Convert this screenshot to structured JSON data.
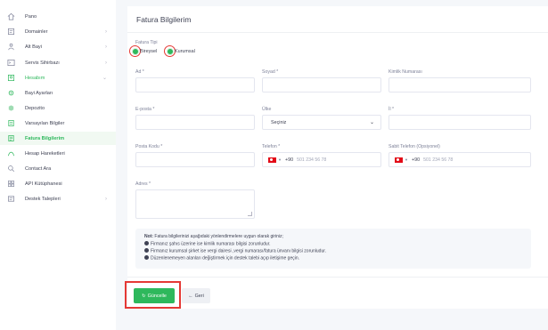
{
  "sidebar": {
    "items": [
      {
        "label": "Pano",
        "icon": "home-icon"
      },
      {
        "label": "Domainler",
        "icon": "domain-icon",
        "chevron": "›"
      },
      {
        "label": "Alt Bayi",
        "icon": "users-icon",
        "chevron": "›"
      },
      {
        "label": "Servis Sihirbazı",
        "icon": "terminal-icon",
        "chevron": "›"
      },
      {
        "label": "Hesabım",
        "icon": "account-icon",
        "chevron": "⌄"
      },
      {
        "label": "Bayi Ayarları",
        "icon": "settings-icon"
      },
      {
        "label": "Depozito",
        "icon": "deposit-icon"
      },
      {
        "label": "Varsayılan Bilgiler",
        "icon": "default-info-icon"
      },
      {
        "label": "Fatura Bilgilerim",
        "icon": "invoice-icon"
      },
      {
        "label": "Hesap Hareketleri",
        "icon": "activity-icon"
      },
      {
        "label": "Contact Ara",
        "icon": "search-icon"
      },
      {
        "label": "API Kütüphanesi",
        "icon": "api-icon"
      },
      {
        "label": "Destek Talepleri",
        "icon": "support-icon",
        "chevron": "›"
      }
    ]
  },
  "page": {
    "title": "Fatura Bilgilerim"
  },
  "form": {
    "invoice_type_label": "Fatura Tipi",
    "radio_individual": "Bireysel",
    "radio_corporate": "Kurumsal",
    "name_label": "Ad *",
    "surname_label": "Soyad *",
    "id_label": "Kimlik Numarası",
    "email_label": "E-posta *",
    "country_label": "Ülke",
    "country_value": "Seçiniz",
    "city_label": "İl *",
    "zip_label": "Posta Kodu *",
    "phone_label": "Telefon *",
    "landline_label": "Sabit Telefon (Opsiyonel)",
    "dial_code": "+90",
    "phone_placeholder": "501 234 56 78",
    "address_label": "Adres *"
  },
  "note": {
    "title": "Not:",
    "intro": "Fatura bilgilerinizi aşağıdaki yönlendirmelere uygun olarak giriniz;",
    "line1": "Firmanız şahıs üzerine ise kimlik numarası bilgisi zorunludur.",
    "line2": "Firmanız kurumsal şirket ise vergi dairesi ,vergi numarası/fatura ünvanı bilgisi zorunludur.",
    "line3": "Düzenlenemeyen alanları değiştirmek için destek talebi açıp iletişime geçin."
  },
  "actions": {
    "save_label": "Güncelle",
    "back_label": "Geri",
    "save_icon": "↻",
    "back_icon": "←"
  },
  "colors": {
    "accent": "#2eb85c",
    "highlight": "#e53935"
  }
}
